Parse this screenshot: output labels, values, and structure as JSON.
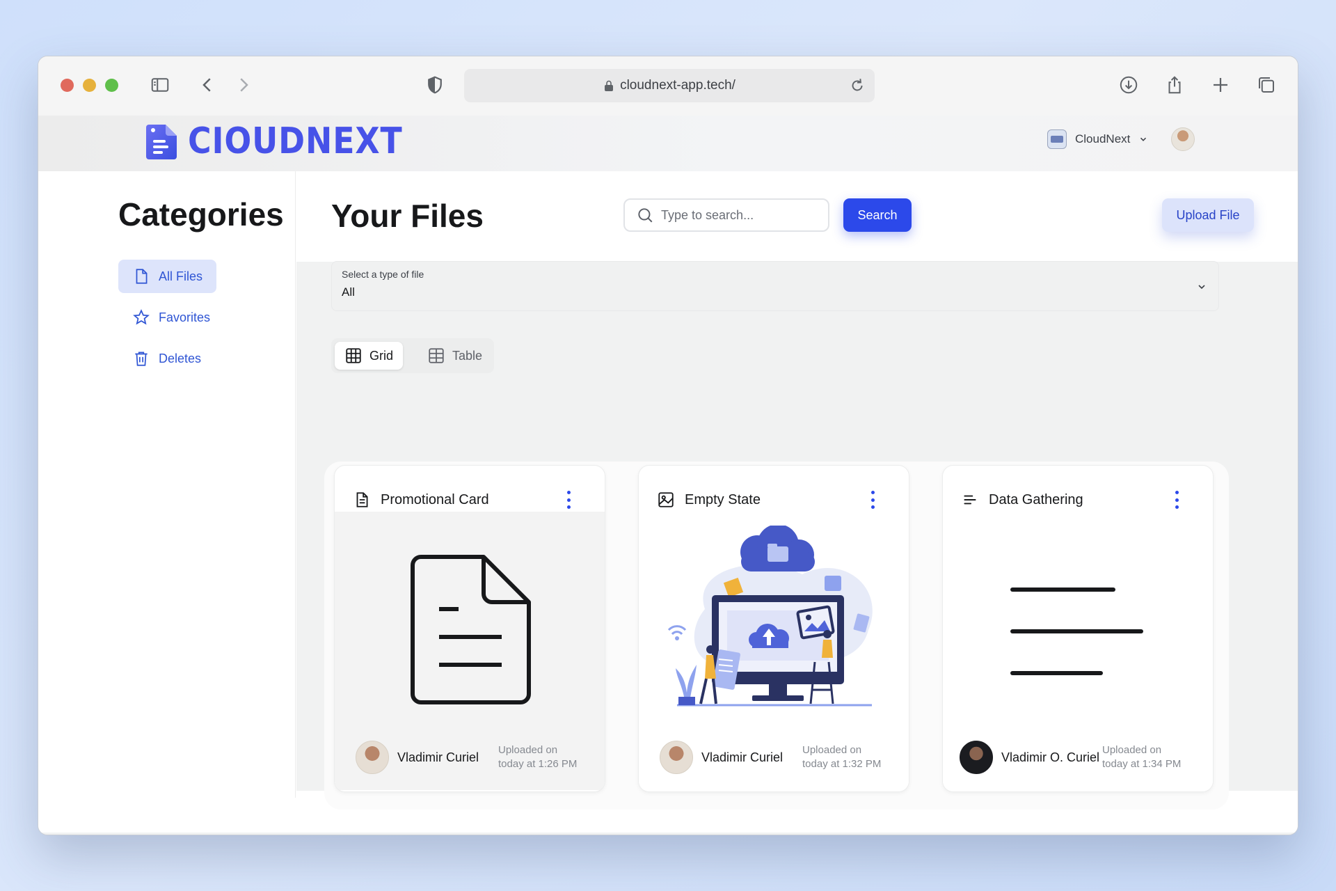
{
  "browser": {
    "url": "cloudnext-app.tech/"
  },
  "header": {
    "brand": "CIOUDNEXT",
    "account_name": "CloudNext"
  },
  "sidebar": {
    "title": "Categories",
    "items": [
      {
        "label": "All Files",
        "icon": "file-icon",
        "active": true
      },
      {
        "label": "Favorites",
        "icon": "star-icon",
        "active": false
      },
      {
        "label": "Deletes",
        "icon": "trash-icon",
        "active": false
      }
    ]
  },
  "main": {
    "title": "Your Files",
    "search_placeholder": "Type to search...",
    "search_label": "Search",
    "upload_label": "Upload File",
    "type_select": {
      "label": "Select a type of file",
      "value": "All"
    },
    "views": {
      "grid": "Grid",
      "table": "Table",
      "selected": "grid"
    }
  },
  "files": [
    {
      "title": "Promotional Card",
      "type_icon": "document-icon",
      "author": "Vladimir Curiel",
      "uploaded_label": "Uploaded on",
      "uploaded_time": "today at 1:26 PM"
    },
    {
      "title": "Empty State",
      "type_icon": "image-icon",
      "author": "Vladimir Curiel",
      "uploaded_label": "Uploaded on",
      "uploaded_time": "today at 1:32 PM"
    },
    {
      "title": "Data Gathering",
      "type_icon": "text-lines-icon",
      "author": "Vladimir O. Curiel",
      "uploaded_label": "Uploaded on",
      "uploaded_time": "today at 1:34 PM"
    }
  ],
  "colors": {
    "accent": "#2c49ea",
    "brand": "#4752e8",
    "nav_active_bg": "#dde4fb"
  }
}
